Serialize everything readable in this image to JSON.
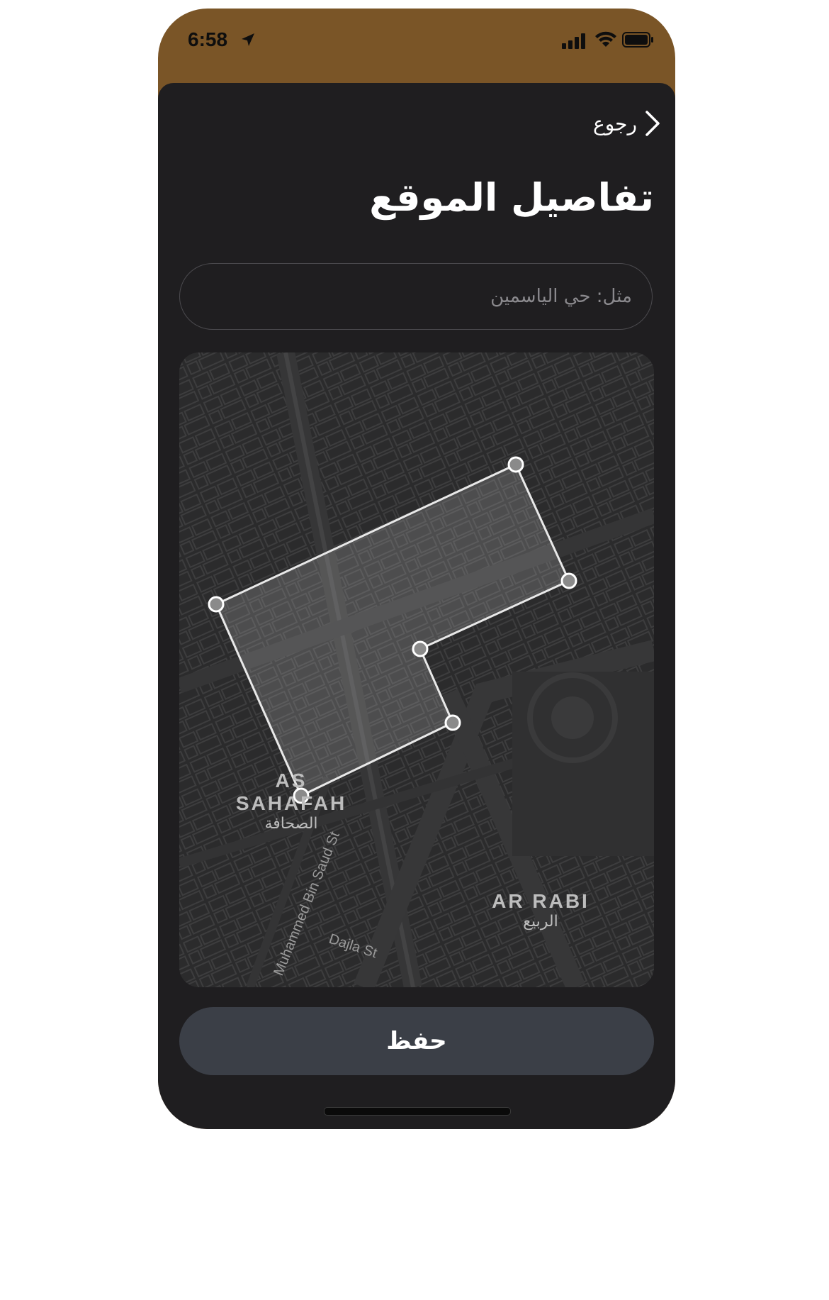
{
  "status_bar": {
    "time": "6:58"
  },
  "header": {
    "back_label": "رجوع",
    "title": "تفاصيل الموقع"
  },
  "search": {
    "placeholder": "مثل: حي الياسمين",
    "value": ""
  },
  "map": {
    "labels": [
      {
        "en": "AS SAHAFAH",
        "ar": "الصحافة"
      },
      {
        "en": "AR RABI",
        "ar": "الربيع"
      }
    ],
    "streets": [
      "Dajla St",
      "Muhammed Bin Saud St"
    ]
  },
  "actions": {
    "save_label": "حفظ"
  },
  "colors": {
    "status_bg": "#7a5527",
    "sheet_bg": "#1f1e20",
    "button_bg": "#3b3f47",
    "map_bg": "#2b2b2c"
  }
}
